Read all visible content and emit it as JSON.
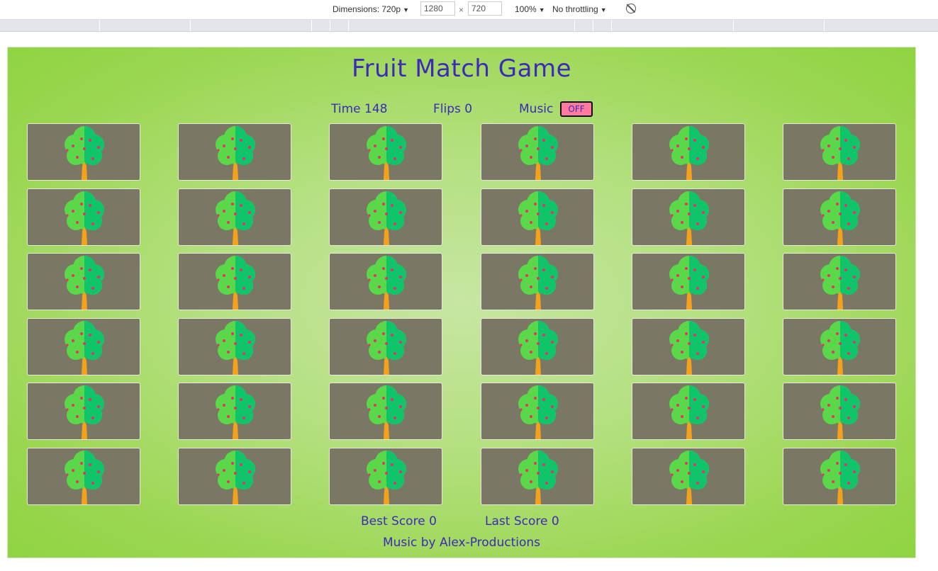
{
  "devtools": {
    "dimensions_label": "Dimensions: 720p",
    "width_value": "1280",
    "height_value": "720",
    "times": "×",
    "zoom": "100%",
    "throttling": "No throttling",
    "rotate_icon": "rotate-icon"
  },
  "game": {
    "title": "Fruit Match Game",
    "time_label": "Time 148",
    "flips_label": "Flips 0",
    "music_label": "Music",
    "music_toggle": "OFF",
    "best_score": "Best Score 0",
    "last_score": "Last Score 0",
    "credit": "Music by Alex-Productions",
    "card_back_icon": "tree-icon",
    "rows": 6,
    "columns": 6,
    "colors": {
      "text": "#3c2ab8",
      "card_back": "#7a7764",
      "toggle_bg": "#ff7a9e",
      "tree_light": "#5ad84a",
      "tree_dark": "#10c46a",
      "trunk": "#f4a11c",
      "fruit": "#e8306a"
    }
  }
}
